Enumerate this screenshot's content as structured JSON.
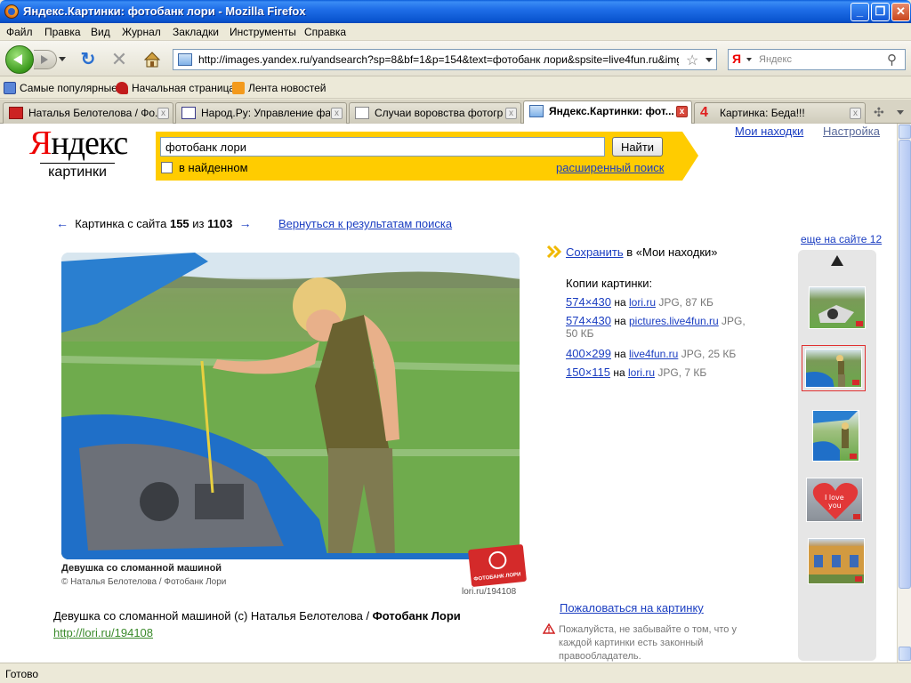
{
  "window": {
    "title": "Яндекс.Картинки: фотобанк лори - Mozilla Firefox",
    "min": "_",
    "max": "❐",
    "close": "✕"
  },
  "menu": [
    "Файл",
    "Правка",
    "Вид",
    "Журнал",
    "Закладки",
    "Инструменты",
    "Справка"
  ],
  "nav": {
    "url": "http://images.yandex.ru/yandsearch?sp=8&bf=1&p=154&text=фотобанк лори&spsite=live4fun.ru&img_url=lo",
    "search_logo": "Я",
    "search_placeholder": "Яндекс"
  },
  "bookmarks": [
    "Самые популярные",
    "Начальная страница",
    "Лента новостей"
  ],
  "tabs": [
    {
      "label": "Наталья Белотелова / Фо...",
      "active": false
    },
    {
      "label": "Народ.Ру: Управление фа...",
      "active": false
    },
    {
      "label": "Случаи воровства фотогр...",
      "active": false
    },
    {
      "label": "Яндекс.Картинки: фот...",
      "active": true
    },
    {
      "label": "Картинка: Беда!!!",
      "active": false
    }
  ],
  "tab_bar": {
    "add": "✣"
  },
  "page": {
    "logo_ya": "Я",
    "logo_rest": "ндекс",
    "logo_sub": "картинки",
    "search_query": "фотобанк лори",
    "search_button": "Найти",
    "in_found": "в найденном",
    "advanced": "расширенный поиск",
    "my_finds": "Мои находки",
    "settings": "Настройка",
    "pager_left_arrow": "←",
    "pager_text": "Картинка с сайта",
    "pager_current": "155",
    "pager_of": "из",
    "pager_total": "1103",
    "pager_right_arrow": "→",
    "back_to_results": "Вернуться к результатам поиска",
    "more_on_site": "еще на сайте 12",
    "photo_caption_title": "Девушка со сломанной машиной",
    "photo_caption_author": "© Наталья Белотелова / Фотобанк Лори",
    "photo_logo_text": "ФОТОБАНК ЛОРИ",
    "photo_id": "lori.ru/194108",
    "desc_main": "Девушка со сломанной машиной (c) Наталья Белотелова / ",
    "desc_bold": "Фотобанк Лори",
    "desc_link": "http://lori.ru/194108",
    "save_link": "Сохранить",
    "save_rest": " в «Мои находки»",
    "copies_title": "Копии картинки:",
    "copies": [
      {
        "size": "574×430",
        "on": "на",
        "site": "lori.ru",
        "meta": "JPG, 87 КБ"
      },
      {
        "size": "574×430",
        "on": "на",
        "site": "pictures.live4fun.ru",
        "meta": "JPG,",
        "meta2": "50 КБ"
      },
      {
        "size": "400×299",
        "on": "на",
        "site": "live4fun.ru",
        "meta": "JPG, 25 КБ"
      },
      {
        "size": "150×115",
        "on": "на",
        "site": "lori.ru",
        "meta": "JPG, 7 КБ"
      }
    ],
    "complain": "Пожаловаться на картинку",
    "warning": "Пожалуйста, не забывайте о том, что у каждой картинки есть законный правообладатель."
  },
  "status": "Готово"
}
